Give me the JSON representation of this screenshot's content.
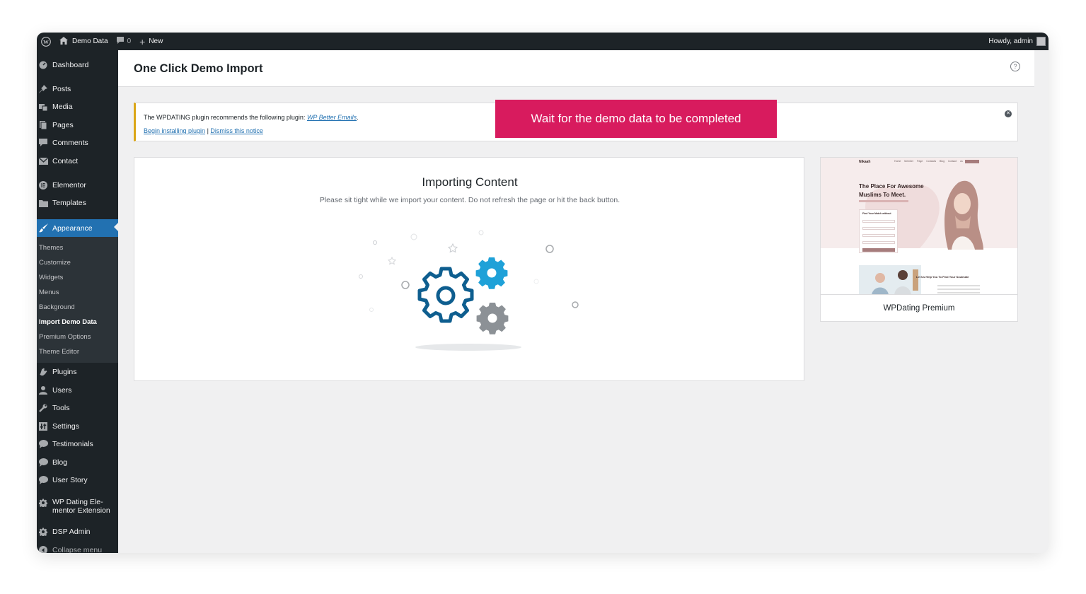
{
  "admin_bar": {
    "site_name": "Demo Data",
    "comments_count": "0",
    "new_label": "New",
    "greeting": "Howdy, admin"
  },
  "sidebar": {
    "items": [
      {
        "label": "Dashboard",
        "icon": "dashboard-icon"
      },
      {
        "label": "Posts",
        "icon": "pin-icon"
      },
      {
        "label": "Media",
        "icon": "media-icon"
      },
      {
        "label": "Pages",
        "icon": "pages-icon"
      },
      {
        "label": "Comments",
        "icon": "comment-icon"
      },
      {
        "label": "Contact",
        "icon": "mail-icon"
      },
      {
        "label": "Elementor",
        "icon": "elementor-icon"
      },
      {
        "label": "Templates",
        "icon": "folder-icon"
      },
      {
        "label": "Appearance",
        "icon": "brush-icon"
      },
      {
        "label": "Plugins",
        "icon": "plug-icon"
      },
      {
        "label": "Users",
        "icon": "user-icon"
      },
      {
        "label": "Tools",
        "icon": "wrench-icon"
      },
      {
        "label": "Settings",
        "icon": "settings-icon"
      },
      {
        "label": "Testimonials",
        "icon": "comment-icon"
      },
      {
        "label": "Blog",
        "icon": "comment-icon"
      },
      {
        "label": "User Story",
        "icon": "comment-icon"
      },
      {
        "label": "WP Dating Ele-",
        "label2": "mentor Extension",
        "icon": "gear-icon"
      },
      {
        "label": "DSP Admin",
        "icon": "gear-icon"
      },
      {
        "label": "Collapse menu",
        "icon": "collapse-icon"
      }
    ],
    "submenu": [
      "Themes",
      "Customize",
      "Widgets",
      "Menus",
      "Background",
      "Import Demo Data",
      "Premium Options",
      "Theme Editor"
    ]
  },
  "page": {
    "title": "One Click Demo Import",
    "help_icon": "?"
  },
  "notice": {
    "text": "The WPDATING plugin recommends the following plugin: ",
    "plugin_link": "WP Better Emails",
    "text_end": ".",
    "install_link": "Begin installing plugin",
    "separator": " | ",
    "dismiss_link": "Dismiss this notice"
  },
  "banner": {
    "text": "Wait for the demo data to be completed"
  },
  "import": {
    "title": "Importing Content",
    "subtitle": "Please sit tight while we import your content. Do not refresh the page or hit the back button."
  },
  "theme": {
    "name": "WPDating Premium",
    "preview_logo": "Nikaah",
    "preview_nav": "Home Member Page Contacts Blog Contact us Login",
    "preview_title_line1": "The Place For Awesome",
    "preview_title_line2": "Muslims To Meet.",
    "preview_form_title": "Find Your Match without",
    "preview_lower_title": "Let Us Help You To Find Your Soulmate"
  },
  "colors": {
    "admin_dark": "#1d2327",
    "accent_blue": "#2271b1",
    "banner_pink": "#d81b5e",
    "notice_yellow": "#dba617",
    "gear_dark_blue": "#0e5e8f",
    "gear_light_blue": "#1fa1d8",
    "gear_gray": "#8c9196"
  }
}
